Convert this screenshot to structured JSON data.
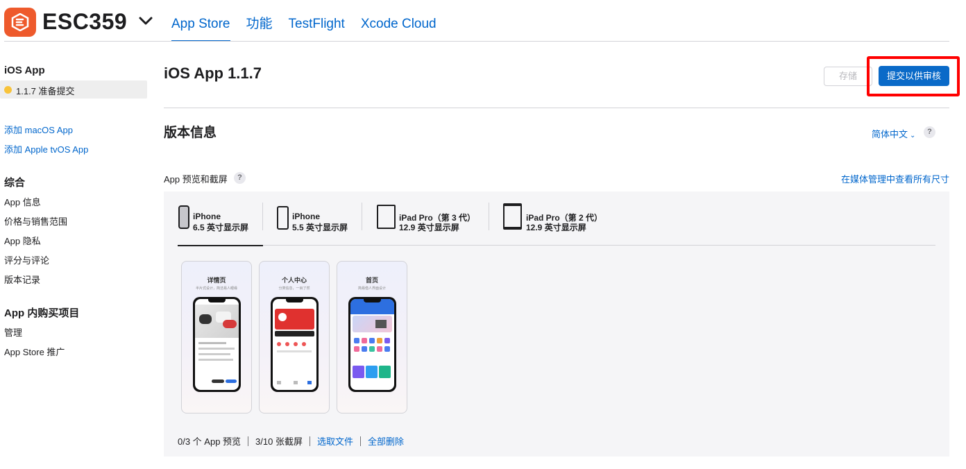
{
  "header": {
    "app_name": "ESC359",
    "tabs": [
      {
        "label": "App Store",
        "active": true
      },
      {
        "label": "功能",
        "active": false
      },
      {
        "label": "TestFlight",
        "active": false
      },
      {
        "label": "Xcode Cloud",
        "active": false
      }
    ]
  },
  "sidebar": {
    "ios_heading": "iOS App",
    "selected_version": "1.1.7 准备提交",
    "add_macos": "添加 macOS App",
    "add_tvos": "添加 Apple tvOS App",
    "general_heading": "综合",
    "general_items": [
      "App 信息",
      "价格与销售范围",
      "App 隐私",
      "评分与评论",
      "版本记录"
    ],
    "iap_heading": "App 内购买项目",
    "iap_items": [
      "管理",
      "App Store 推广"
    ]
  },
  "main": {
    "title": "iOS App 1.1.7",
    "save_label": "存储",
    "submit_label": "提交以供审核",
    "section_title": "版本信息",
    "language": "简体中文",
    "help_glyph": "?",
    "preview_label": "App 预览和截屏",
    "media_link": "在媒体管理中查看所有尺寸",
    "devices": [
      {
        "name": "iPhone",
        "size": "6.5 英寸显示屏",
        "active": true
      },
      {
        "name": "iPhone",
        "size": "5.5 英寸显示屏",
        "active": false
      },
      {
        "name": "iPad Pro（第 3 代）",
        "size": "12.9 英寸显示屏",
        "active": false
      },
      {
        "name": "iPad Pro（第 2 代）",
        "size": "12.9 英寸显示屏",
        "active": false
      }
    ],
    "screenshots": [
      {
        "caption": "详情页",
        "subcaption": "半片式设计，简洁易人眼缘"
      },
      {
        "caption": "个人中心",
        "subcaption": "分类信息，一目了然"
      },
      {
        "caption": "首页",
        "subcaption": "简易借人界面设计"
      }
    ],
    "footer": {
      "previews": "0/3 个 App 预览",
      "screenshots": "3/10 张截屏",
      "choose_file": "选取文件",
      "delete_all": "全部删除"
    }
  },
  "colors": {
    "accent": "#0066cc",
    "submit_bg": "#0a6ac8",
    "highlight": "#ff0000",
    "logo": "#ee5a2c",
    "status_dot": "#f8c33a"
  }
}
